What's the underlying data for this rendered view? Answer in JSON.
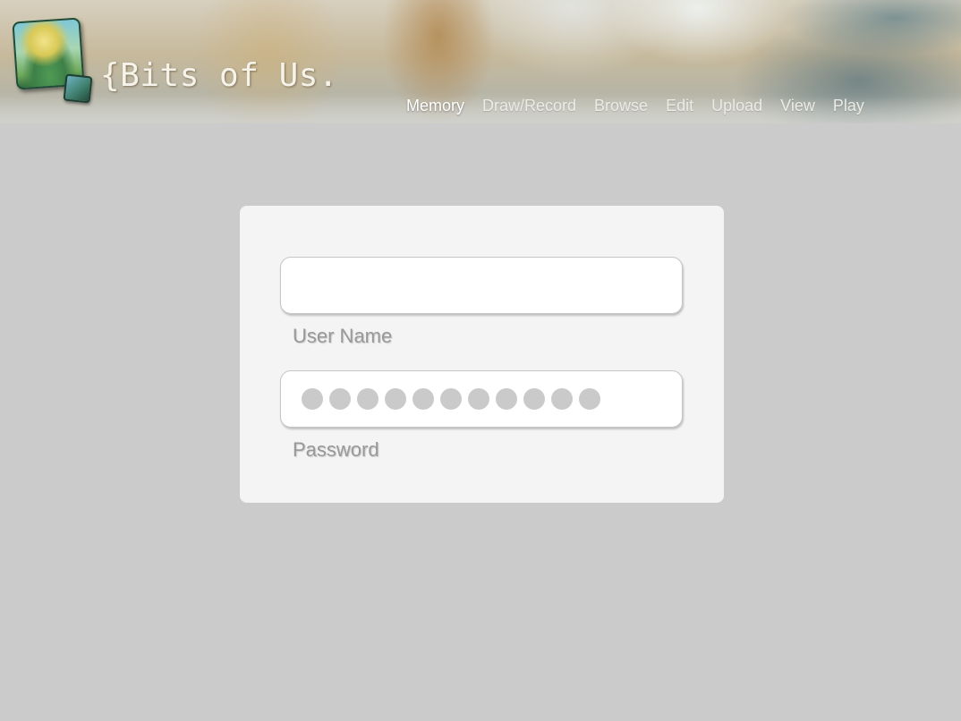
{
  "app": {
    "logo_text": "{Bits of Us."
  },
  "nav": {
    "items": [
      {
        "label": "Memory",
        "active": true
      },
      {
        "label": "Draw/Record",
        "active": false
      },
      {
        "label": "Browse",
        "active": false
      },
      {
        "label": "Edit",
        "active": false
      },
      {
        "label": "Upload",
        "active": false
      },
      {
        "label": "View",
        "active": false
      },
      {
        "label": "Play",
        "active": false
      }
    ]
  },
  "login": {
    "username_value": "",
    "username_label": "User Name",
    "password_dot_count": 11,
    "password_label": "Password"
  },
  "colors": {
    "background": "#cbcbcb",
    "panel": "#f4f4f4",
    "field": "#ffffff",
    "password_dot": "#cacaca",
    "label": "#999999",
    "nav_text": "#ecebe6"
  },
  "icons": {
    "logo": "photo-stack-icon"
  }
}
